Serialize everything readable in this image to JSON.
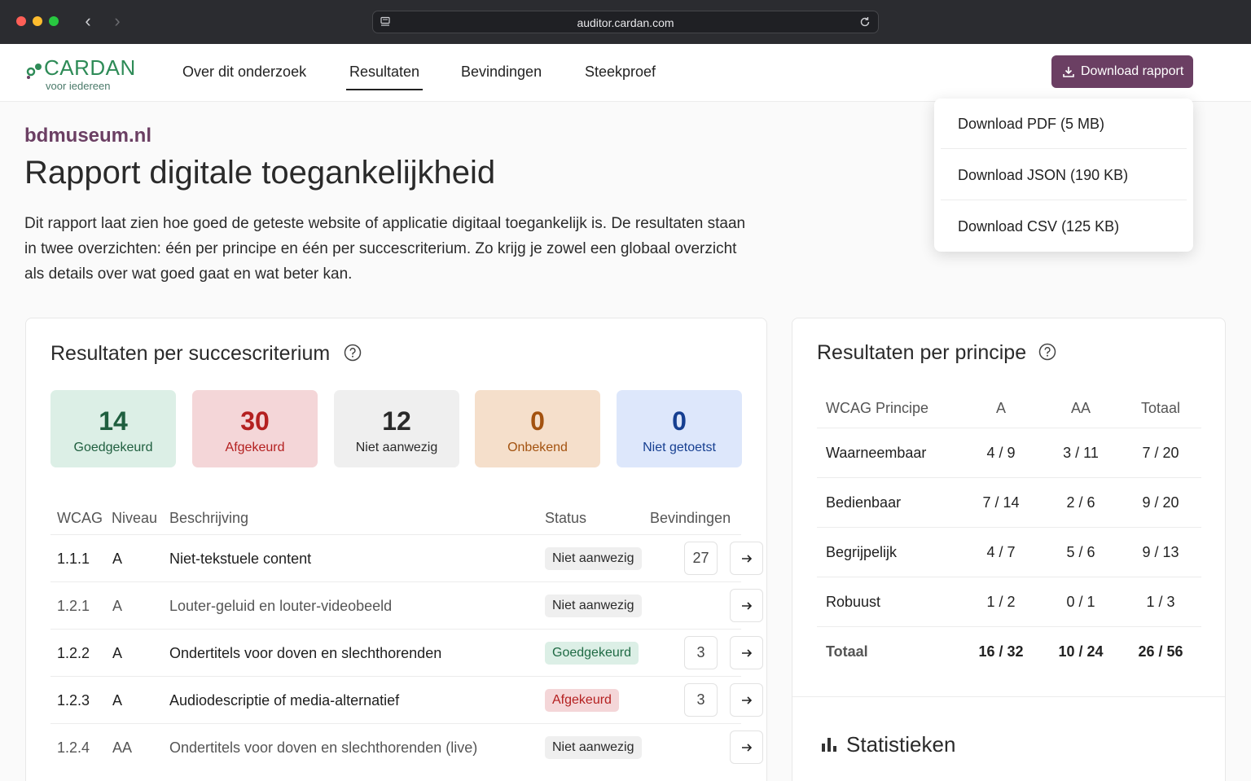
{
  "browser": {
    "url": "auditor.cardan.com"
  },
  "header": {
    "logo_brand": "CARDAN",
    "logo_tagline": "voor iedereen",
    "nav": [
      {
        "label": "Over dit onderzoek"
      },
      {
        "label": "Resultaten"
      },
      {
        "label": "Bevindingen"
      },
      {
        "label": "Steekproef"
      }
    ],
    "download_label": "Download rapport"
  },
  "dropdown": {
    "items": [
      {
        "label": "Download PDF (5 MB)"
      },
      {
        "label": "Download JSON (190 KB)"
      },
      {
        "label": "Download CSV (125 KB)"
      }
    ]
  },
  "page": {
    "site_name": "bdmuseum.nl",
    "title": "Rapport digitale toegankelijkheid",
    "intro": "Dit rapport laat zien hoe goed de geteste website of applicatie digitaal toegankelijk is. De resultaten staan in twee overzichten: één per principe en één per succescriterium. Zo krijg je zowel een globaal overzicht als details over wat goed gaat en wat beter kan."
  },
  "criteria": {
    "title": "Resultaten per succescriterium",
    "tiles": [
      {
        "value": "14",
        "label": "Goedgekeurd",
        "bg": "#dcefe6",
        "color": "#1f5f3f"
      },
      {
        "value": "30",
        "label": "Afgekeurd",
        "bg": "#f4d6d8",
        "color": "#b42020"
      },
      {
        "value": "12",
        "label": "Niet aanwezig",
        "bg": "#efefef",
        "color": "#2a2a2a"
      },
      {
        "value": "0",
        "label": "Onbekend",
        "bg": "#f5dfcb",
        "color": "#a3520f"
      },
      {
        "value": "0",
        "label": "Niet getoetst",
        "bg": "#dde7fb",
        "color": "#163f91"
      }
    ],
    "headers": {
      "wcag": "WCAG",
      "level": "Niveau",
      "desc": "Beschrijving",
      "status": "Status",
      "findings": "Bevindingen"
    },
    "rows": [
      {
        "wcag": "1.1.1",
        "level": "A",
        "desc": "Niet-tekstuele content",
        "status": "Niet aanwezig",
        "count": "27",
        "bold": true
      },
      {
        "wcag": "1.2.1",
        "level": "A",
        "desc": "Louter-geluid en louter-videobeeld",
        "status": "Niet aanwezig",
        "count": "",
        "bold": false
      },
      {
        "wcag": "1.2.2",
        "level": "A",
        "desc": "Ondertitels voor doven en slechthorenden",
        "status": "Goedgekeurd",
        "count": "3",
        "bold": true
      },
      {
        "wcag": "1.2.3",
        "level": "A",
        "desc": "Audiodescriptie of media-alternatief",
        "status": "Afgekeurd",
        "count": "3",
        "bold": true
      },
      {
        "wcag": "1.2.4",
        "level": "AA",
        "desc": "Ondertitels voor doven en slechthorenden (live)",
        "status": "Niet aanwezig",
        "count": "",
        "bold": false
      }
    ]
  },
  "principles": {
    "title": "Resultaten per principe",
    "headers": {
      "principle": "WCAG Principe",
      "a": "A",
      "aa": "AA",
      "total": "Totaal"
    },
    "rows": [
      {
        "name": "Waarneembaar",
        "a": "4 / 9",
        "aa": "3 / 11",
        "total": "7 / 20"
      },
      {
        "name": "Bedienbaar",
        "a": "7 / 14",
        "aa": "2 / 6",
        "total": "9 / 20"
      },
      {
        "name": "Begrijpelijk",
        "a": "4 / 7",
        "aa": "5 / 6",
        "total": "9 / 13"
      },
      {
        "name": "Robuust",
        "a": "1 / 2",
        "aa": "0 / 1",
        "total": "1 / 3"
      }
    ],
    "total": {
      "name": "Totaal",
      "a": "16 / 32",
      "aa": "10 / 24",
      "total": "26 / 56"
    },
    "stats_title": "Statistieken"
  }
}
